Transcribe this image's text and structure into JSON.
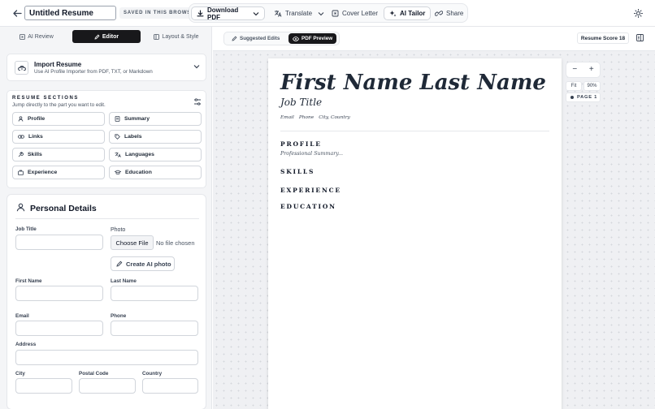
{
  "header": {
    "resume_title": "Untitled Resume",
    "saved_status": "Saved in this browser",
    "download_label": "Download PDF",
    "translate_label": "Translate",
    "cover_letter_label": "Cover Letter",
    "ai_tailor_label": "AI Tailor",
    "share_label": "Share"
  },
  "left_tabs": [
    {
      "label": "AI Review",
      "active": false
    },
    {
      "label": "Editor",
      "active": true
    },
    {
      "label": "Layout & Style",
      "active": false
    }
  ],
  "import": {
    "title": "Import Resume",
    "subtitle": "Use AI Profile Importer from PDF, TXT, or Markdown"
  },
  "sections_nav": {
    "label": "Resume Sections",
    "subtitle": "Jump directly to the part you want to edit.",
    "items": [
      "Profile",
      "Summary",
      "Links",
      "Labels",
      "Skills",
      "Languages",
      "Experience",
      "Education"
    ]
  },
  "personal_details": {
    "title": "Personal Details",
    "job_title_label": "Job Title",
    "photo_label": "Photo",
    "choose_file_label": "Choose File",
    "no_file_text": "No file chosen",
    "create_ai_photo_label": "Create AI photo",
    "first_name_label": "First Name",
    "last_name_label": "Last Name",
    "email_label": "Email",
    "phone_label": "Phone",
    "address_label": "Address",
    "city_label": "City",
    "postal_code_label": "Postal Code",
    "country_label": "Country"
  },
  "preview_bar": {
    "suggested_edits_label": "Suggested Edits",
    "pdf_preview_label": "PDF Preview",
    "pdf_preview_active": true,
    "score_label": "Resume Score 18"
  },
  "resume_preview": {
    "first_name": "First Name",
    "last_name": "Last Name",
    "job_title": "Job Title",
    "email": "Email",
    "phone": "Phone",
    "location": "City, Country",
    "profile_heading": "Profile",
    "summary_placeholder": "Professional Summary...",
    "skills_heading": "Skills",
    "experience_heading": "Experience",
    "education_heading": "Education"
  },
  "zoom": {
    "minus": "−",
    "plus": "+",
    "fit_label": "Fit",
    "percent": "90%",
    "page_label": "Page 1"
  },
  "colors": {
    "accent_dark": "#18181b",
    "panel_bg": "#f4f5f7",
    "canvas_bg": "#eff0f3"
  }
}
